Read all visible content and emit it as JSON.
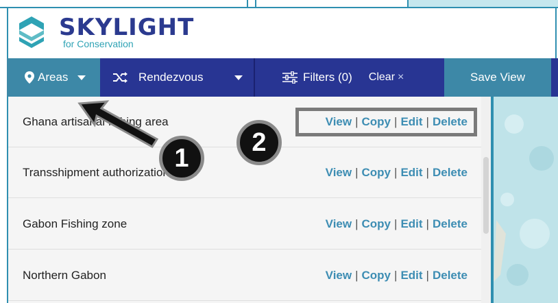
{
  "logo": {
    "word": "SKYLIGHT",
    "sub": "for Conservation"
  },
  "toolbar": {
    "areas_label": "Areas",
    "rendezvous_label": "Rendezvous",
    "filters_label": "Filters (0)",
    "clear_label": "Clear",
    "clear_x": "×",
    "save_label": "Save View"
  },
  "areas": [
    {
      "name": "Ghana artisanal fishing area",
      "view": "View",
      "copy": "Copy",
      "edit": "Edit",
      "delete": "Delete"
    },
    {
      "name": "Transshipment authorization zone",
      "view": "View",
      "copy": "Copy",
      "edit": "Edit",
      "delete": "Delete"
    },
    {
      "name": "Gabon Fishing zone",
      "view": "View",
      "copy": "Copy",
      "edit": "Edit",
      "delete": "Delete"
    },
    {
      "name": "Northern Gabon",
      "view": "View",
      "copy": "Copy",
      "edit": "Edit",
      "delete": "Delete"
    }
  ],
  "annotations": {
    "badge1": "1",
    "badge2": "2"
  },
  "colors": {
    "navy": "#283593",
    "teal": "#3d88a7",
    "link": "#3d8db3",
    "map": "#bfe3e9"
  }
}
